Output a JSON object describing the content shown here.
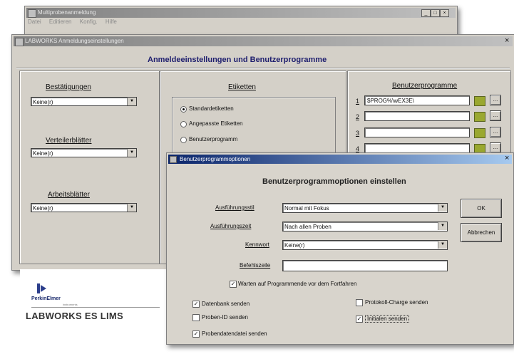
{
  "main_window": {
    "title": "Multiprobenanmeldung",
    "menu": [
      "Datei",
      "Editieren",
      "Konfig.",
      "Hilfe"
    ],
    "controls": [
      "_",
      "□",
      "×"
    ]
  },
  "settings_window": {
    "title": "LABWORKS Anmeldungseinstellungen",
    "heading": "Anmeldeeinstellungen und Benutzerprogramme",
    "close": "×",
    "left": {
      "bestaetigungen_label": "Bestätigungen",
      "bestaetigungen_value": "Keine(r)",
      "verteiler_label": "Verteilerblätter",
      "verteiler_value": "Keine(r)",
      "arbeits_label": "Arbeitsblätter",
      "arbeits_value": "Keine(r)"
    },
    "etiketten": {
      "label": "Etiketten",
      "options": [
        "Standardetiketten",
        "Angepasste Etiketten",
        "Benutzerprogramm"
      ],
      "selected_index": 0
    },
    "benutzerprogramme": {
      "label": "Benutzerprogramme",
      "rows": [
        {
          "num": "1",
          "value": "$PROG%\\wEX3E\\"
        },
        {
          "num": "2",
          "value": ""
        },
        {
          "num": "3",
          "value": ""
        },
        {
          "num": "4",
          "value": ""
        }
      ],
      "more_label": "..."
    }
  },
  "logo": {
    "company": "PerkinElmer",
    "tagline": "instruments",
    "product": "LABWORKS ES LIMS"
  },
  "options_dialog": {
    "title": "Benutzerprogrammoptionen",
    "close": "×",
    "heading": "Benutzerprogrammoptionen einstellen",
    "fields": {
      "ausfuehrungsstil_label": "Ausführungsstil",
      "ausfuehrungsstil_value": "Normal mit Fokus",
      "ausfuehrungszeit_label": "Ausführungszeit",
      "ausfuehrungszeit_value": "Nach allen Proben",
      "kennwort_label": "Kennwort",
      "kennwort_value": "Keine(r)",
      "befehlszeile_label": "Befehlszeile",
      "befehlszeile_value": ""
    },
    "ok_label": "OK",
    "cancel_label": "Abbrechen",
    "wait_label": "Warten auf Programmende vor dem Fortfahren",
    "checkboxes": [
      {
        "label": "Datenbank senden",
        "checked": true
      },
      {
        "label": "Proben-ID senden",
        "checked": false
      },
      {
        "label": "Probendatendatei senden",
        "checked": true
      },
      {
        "label": "Protokoll-Charge senden",
        "checked": false
      },
      {
        "label": "Initialen senden",
        "checked": true
      }
    ],
    "check_mark": "✓"
  }
}
